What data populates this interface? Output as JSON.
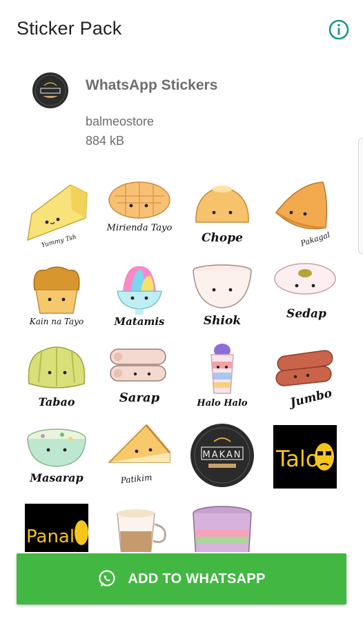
{
  "appbar": {
    "title": "Sticker Pack",
    "info_icon": "info-icon"
  },
  "pack": {
    "tray_icon": "makan-logo",
    "name": "WhatsApp Stickers",
    "publisher": "balmeostore",
    "size": "884 kB"
  },
  "stickers": [
    {
      "label": "Yummy Tsh"
    },
    {
      "label": "Mirienda Tayo"
    },
    {
      "label": "Chope"
    },
    {
      "label": "Pakagal"
    },
    {
      "label": "Kain na Tayo"
    },
    {
      "label": "Matamis"
    },
    {
      "label": "Shiok"
    },
    {
      "label": "Sedap"
    },
    {
      "label": "Tabao"
    },
    {
      "label": "Sarap"
    },
    {
      "label": "Halo Halo"
    },
    {
      "label": "Jumbo"
    },
    {
      "label": "Masarap"
    },
    {
      "label": "Patikim"
    },
    {
      "label": "MAKAN"
    },
    {
      "label": "Talo"
    },
    {
      "label": "Panalo"
    },
    {
      "label": ""
    },
    {
      "label": ""
    }
  ],
  "add_button": {
    "label": "ADD TO WHATSAPP",
    "icon": "whatsapp-icon"
  },
  "colors": {
    "accent": "#42b842",
    "info": "#1b9688",
    "muted_text": "#6d6d6d"
  }
}
